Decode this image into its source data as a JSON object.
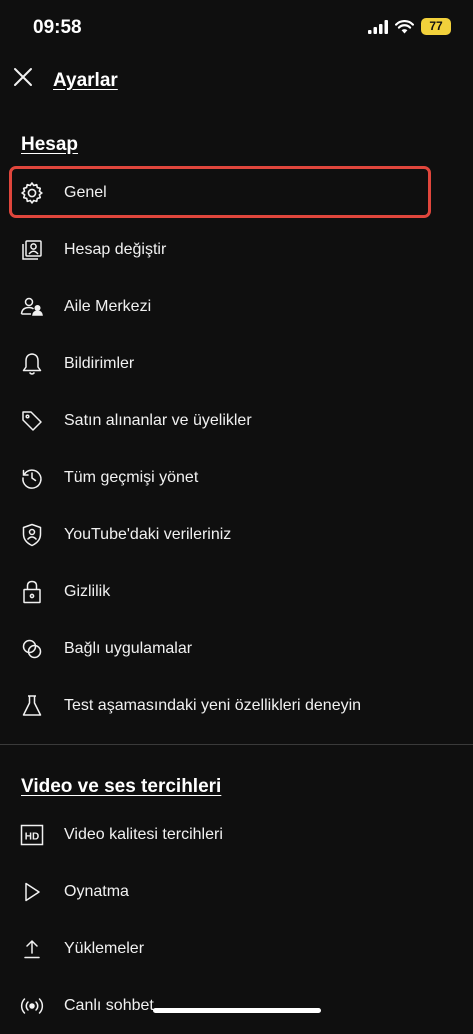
{
  "status_bar": {
    "time": "09:58",
    "battery": "77"
  },
  "header": {
    "title": "Ayarlar"
  },
  "sections": [
    {
      "title": "Hesap",
      "items": [
        {
          "label": "Genel",
          "icon": "gear-icon"
        },
        {
          "label": "Hesap değiştir",
          "icon": "switch-account-icon"
        },
        {
          "label": "Aile Merkezi",
          "icon": "family-icon"
        },
        {
          "label": "Bildirimler",
          "icon": "bell-icon"
        },
        {
          "label": "Satın alınanlar ve üyelikler",
          "icon": "tag-icon"
        },
        {
          "label": "Tüm geçmişi yönet",
          "icon": "history-icon"
        },
        {
          "label": "YouTube'daki verileriniz",
          "icon": "shield-person-icon"
        },
        {
          "label": "Gizlilik",
          "icon": "lock-icon"
        },
        {
          "label": "Bağlı uygulamalar",
          "icon": "linked-apps-icon"
        },
        {
          "label": "Test aşamasındaki yeni özellikleri deneyin",
          "icon": "flask-icon"
        }
      ]
    },
    {
      "title": "Video ve ses tercihleri",
      "items": [
        {
          "label": "Video kalitesi tercihleri",
          "icon": "hd-icon"
        },
        {
          "label": "Oynatma",
          "icon": "play-icon"
        },
        {
          "label": "Yüklemeler",
          "icon": "upload-icon"
        },
        {
          "label": "Canlı sohbet",
          "icon": "live-icon"
        }
      ]
    }
  ],
  "colors": {
    "background": "#0f0f0f",
    "text": "#f1f1f1",
    "highlight": "#e0463c",
    "battery": "#f2d13b"
  }
}
